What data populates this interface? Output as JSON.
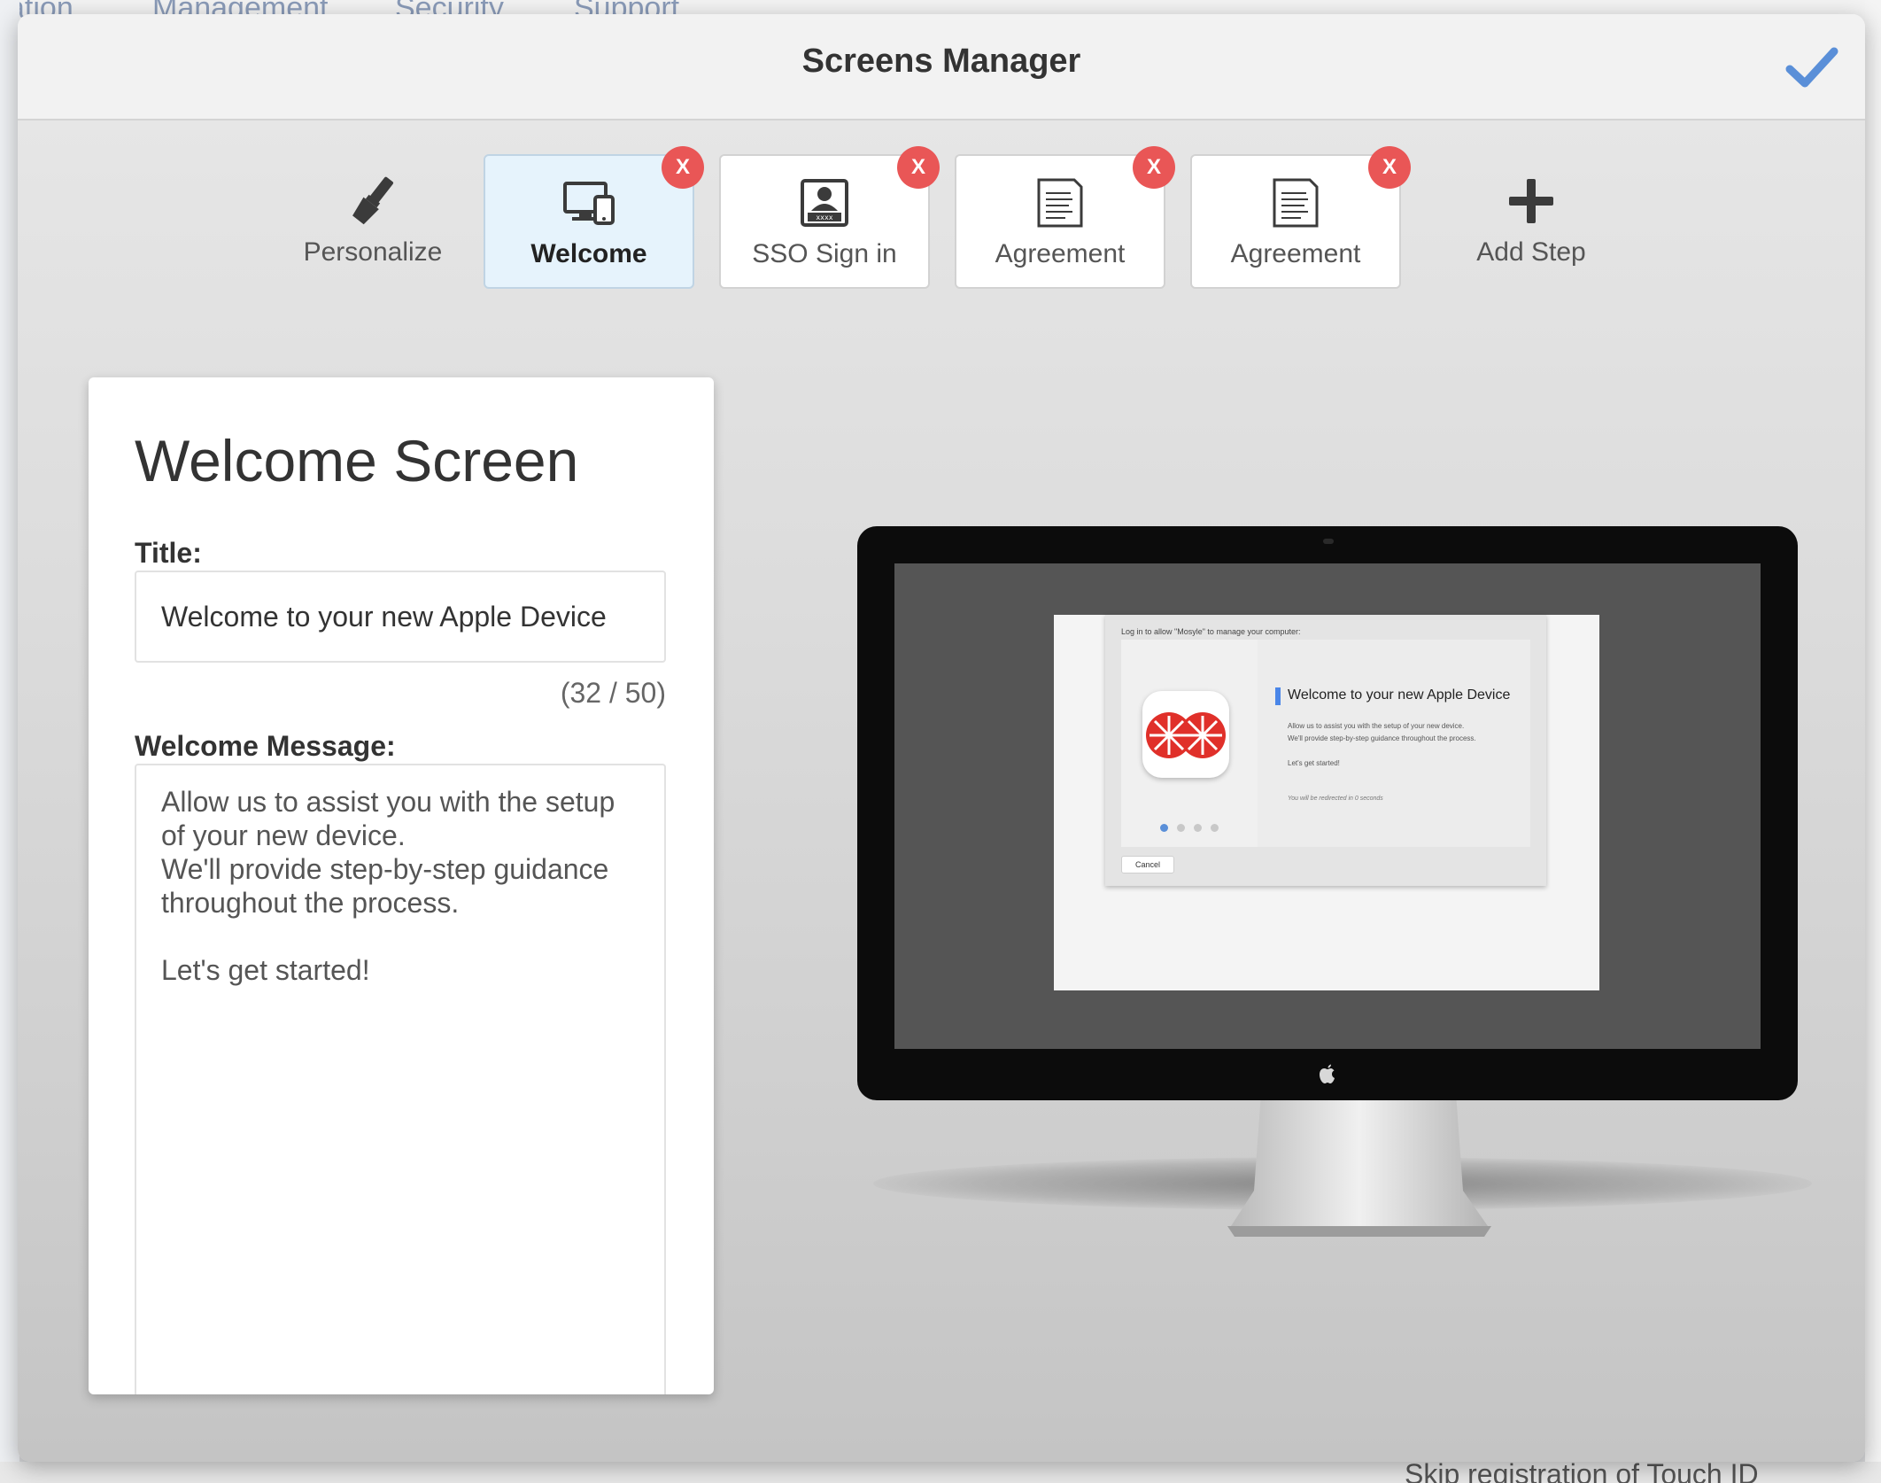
{
  "background": {
    "nav_items": [
      "zation",
      "Management",
      "Security",
      "Support"
    ],
    "bottom_text": "Skip registration of Touch ID"
  },
  "modal": {
    "title": "Screens Manager",
    "confirm_icon": "checkmark-icon"
  },
  "steps": [
    {
      "label": "Personalize",
      "icon": "paintbrush-icon",
      "active": false,
      "removable": false
    },
    {
      "label": "Welcome",
      "icon": "devices-icon",
      "active": true,
      "removable": true
    },
    {
      "label": "SSO Sign in",
      "icon": "user-card-icon",
      "active": false,
      "removable": true
    },
    {
      "label": "Agreement",
      "icon": "document-icon",
      "active": false,
      "removable": true
    },
    {
      "label": "Agreement",
      "icon": "document-icon",
      "active": false,
      "removable": true
    },
    {
      "label": "Add Step",
      "icon": "plus-icon",
      "active": false,
      "removable": false
    }
  ],
  "remove_label": "X",
  "editor": {
    "heading": "Welcome Screen",
    "title_label": "Title:",
    "title_value": "Welcome to your new Apple Device",
    "title_count": "(32 / 50)",
    "message_label": "Welcome Message:",
    "message_value": "Allow us to assist you with the setup of your new device.\nWe'll provide step-by-step guidance throughout the process.\n\nLet's get started!"
  },
  "preview": {
    "prompt": "Log in to allow \"Mosyle\" to manage your computer:",
    "title": "Welcome to your new Apple Device",
    "line1": "Allow us to assist you with the setup of your new device.",
    "line2": "We'll provide step-by-step guidance throughout the process.",
    "line3": "Let's get started!",
    "redirect": "You will be redirected in 0 seconds",
    "cancel": "Cancel",
    "page_dots_total": 4,
    "page_dot_active": 1
  },
  "colors": {
    "accent": "#5a8fd8",
    "remove": "#e95656",
    "active_step": "#e6f3fc"
  }
}
